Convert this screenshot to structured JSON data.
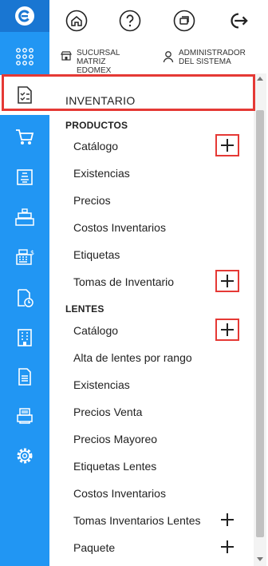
{
  "topbar": {
    "branch_line1": "SUCURSAL",
    "branch_line2": "MATRIZ",
    "branch_line3": "EDOMEX",
    "user_line1": "ADMINISTRADOR",
    "user_line2": "DEL SISTEMA"
  },
  "menu": {
    "title": "INVENTARIO",
    "productos": {
      "label": "PRODUCTOS",
      "items": [
        "Catálogo",
        "Existencias",
        "Precios",
        "Costos Inventarios",
        "Etiquetas",
        "Tomas de Inventario"
      ]
    },
    "lentes": {
      "label": "LENTES",
      "items": [
        "Catálogo",
        "Alta de lentes por rango",
        "Existencias",
        "Precios Venta",
        "Precios Mayoreo",
        "Etiquetas Lentes",
        "Costos Inventarios",
        "Tomas Inventarios Lentes",
        "Paquete"
      ]
    }
  },
  "colors": {
    "rail": "#2196f3",
    "rail_logo": "#1976d2",
    "highlight": "#e53935"
  }
}
